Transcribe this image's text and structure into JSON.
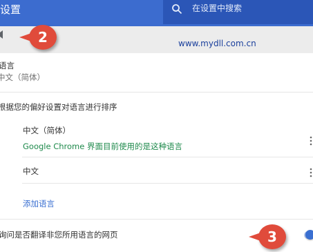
{
  "header": {
    "title": "设置",
    "search_placeholder": "在设置中搜索",
    "search_icon": "search-icon"
  },
  "annotations": {
    "marker_2": "2",
    "marker_3": "3"
  },
  "watermark": "www.mydll.com.cn",
  "languages": {
    "label": "语言",
    "current_value": "中文（简体）",
    "sort_hint": "根据您的偏好设置对语言进行排序",
    "items": [
      {
        "name": "中文（简体）",
        "subtitle": "Google Chrome 界面目前使用的是这种语言"
      },
      {
        "name": "中文"
      }
    ],
    "add_language": "添加语言",
    "translate_prompt": "询问是否翻译非您所用语言的网页",
    "translate_enabled": true
  },
  "colors": {
    "header": "#3c6ccf",
    "search_bg": "#2b56b7",
    "accent": "#3a6fd1",
    "status_green": "#1f8a4c",
    "marker": "#e04b3b"
  }
}
